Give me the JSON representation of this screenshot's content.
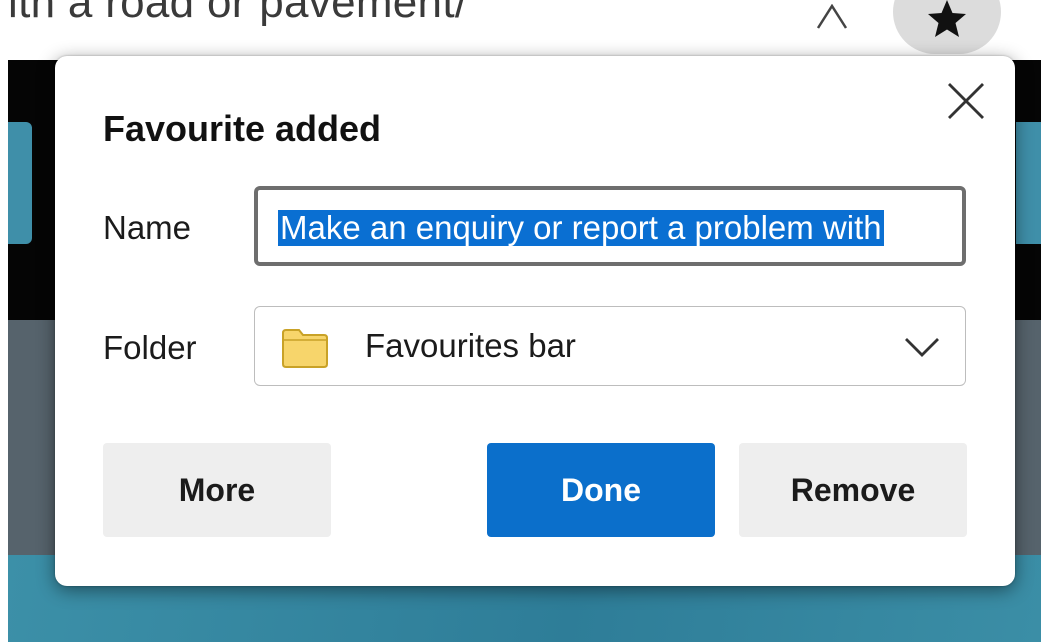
{
  "background": {
    "address_fragment": "ith a road or pavement/"
  },
  "dialog": {
    "title": "Favourite added",
    "name_label": "Name",
    "name_value": "Make an enquiry or report a problem with",
    "folder_label": "Folder",
    "folder_value": "Favourites bar",
    "buttons": {
      "more": "More",
      "done": "Done",
      "remove": "Remove"
    }
  },
  "icons": {
    "close": "close-icon",
    "folder": "folder-icon",
    "chevron": "chevron-down-icon",
    "star": "star-icon",
    "read_aloud": "read-aloud-icon"
  },
  "colors": {
    "accent": "#0b6fcb",
    "selection": "#0a6fd2",
    "folder_fill": "#f7d56b",
    "folder_stroke": "#c9a227"
  }
}
